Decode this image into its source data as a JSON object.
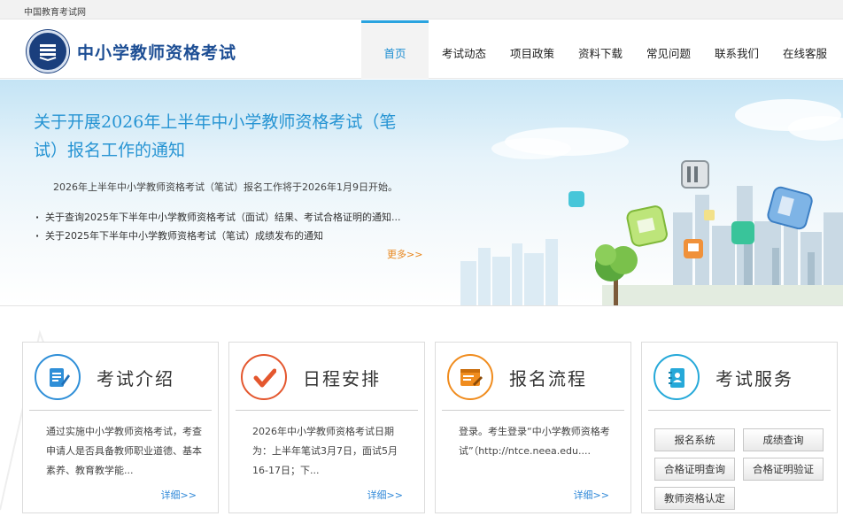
{
  "topbar": {
    "site_label": "中国教育考试网"
  },
  "header": {
    "title": "中小学教师资格考试",
    "logo_icon": "book-emblem-icon"
  },
  "nav": {
    "items": [
      {
        "label": "首页",
        "active": true
      },
      {
        "label": "考试动态"
      },
      {
        "label": "项目政策"
      },
      {
        "label": "资料下载"
      },
      {
        "label": "常见问题"
      },
      {
        "label": "联系我们"
      },
      {
        "label": "在线客服"
      }
    ]
  },
  "banner": {
    "headline": "关于开展2026年上半年中小学教师资格考试（笔试）报名工作的通知",
    "subline": "2026年上半年中小学教师资格考试（笔试）报名工作将于2026年1月9日开始。",
    "news": [
      "关于查询2025年下半年中小学教师资格考试（面试）结果、考试合格证明的通知...",
      "关于2025年下半年中小学教师资格考试（笔试）成绩发布的通知"
    ],
    "more_label": "更多>>"
  },
  "cards": [
    {
      "title": "考试介绍",
      "icon": "document-pen-icon",
      "text": "通过实施中小学教师资格考试，考查申请人是否具备教师职业道德、基本素养、教育教学能...",
      "more": "详细>>"
    },
    {
      "title": "日程安排",
      "icon": "checkmark-icon",
      "text": "2026年中小学教师资格考试日期为：上半年笔试3月7日，面试5月16-17日；下...",
      "more": "详细>>"
    },
    {
      "title": "报名流程",
      "icon": "browser-form-icon",
      "text": "登录。考生登录“中小学教师资格考试”（http://ntce.neea.edu....",
      "more": "详细>>"
    },
    {
      "title": "考试服务",
      "icon": "contact-book-icon",
      "buttons": [
        "报名系统",
        "成绩查询",
        "合格证明查询",
        "合格证明验证",
        "教师资格认定"
      ]
    }
  ],
  "colors": {
    "accent": "#2aa3df",
    "brand": "#1d4e94",
    "more": "#e8871e",
    "card_icon_1": "#2f8fd8",
    "card_icon_2": "#e4572e",
    "card_icon_3": "#f08c1e",
    "card_icon_4": "#26a9d9"
  }
}
